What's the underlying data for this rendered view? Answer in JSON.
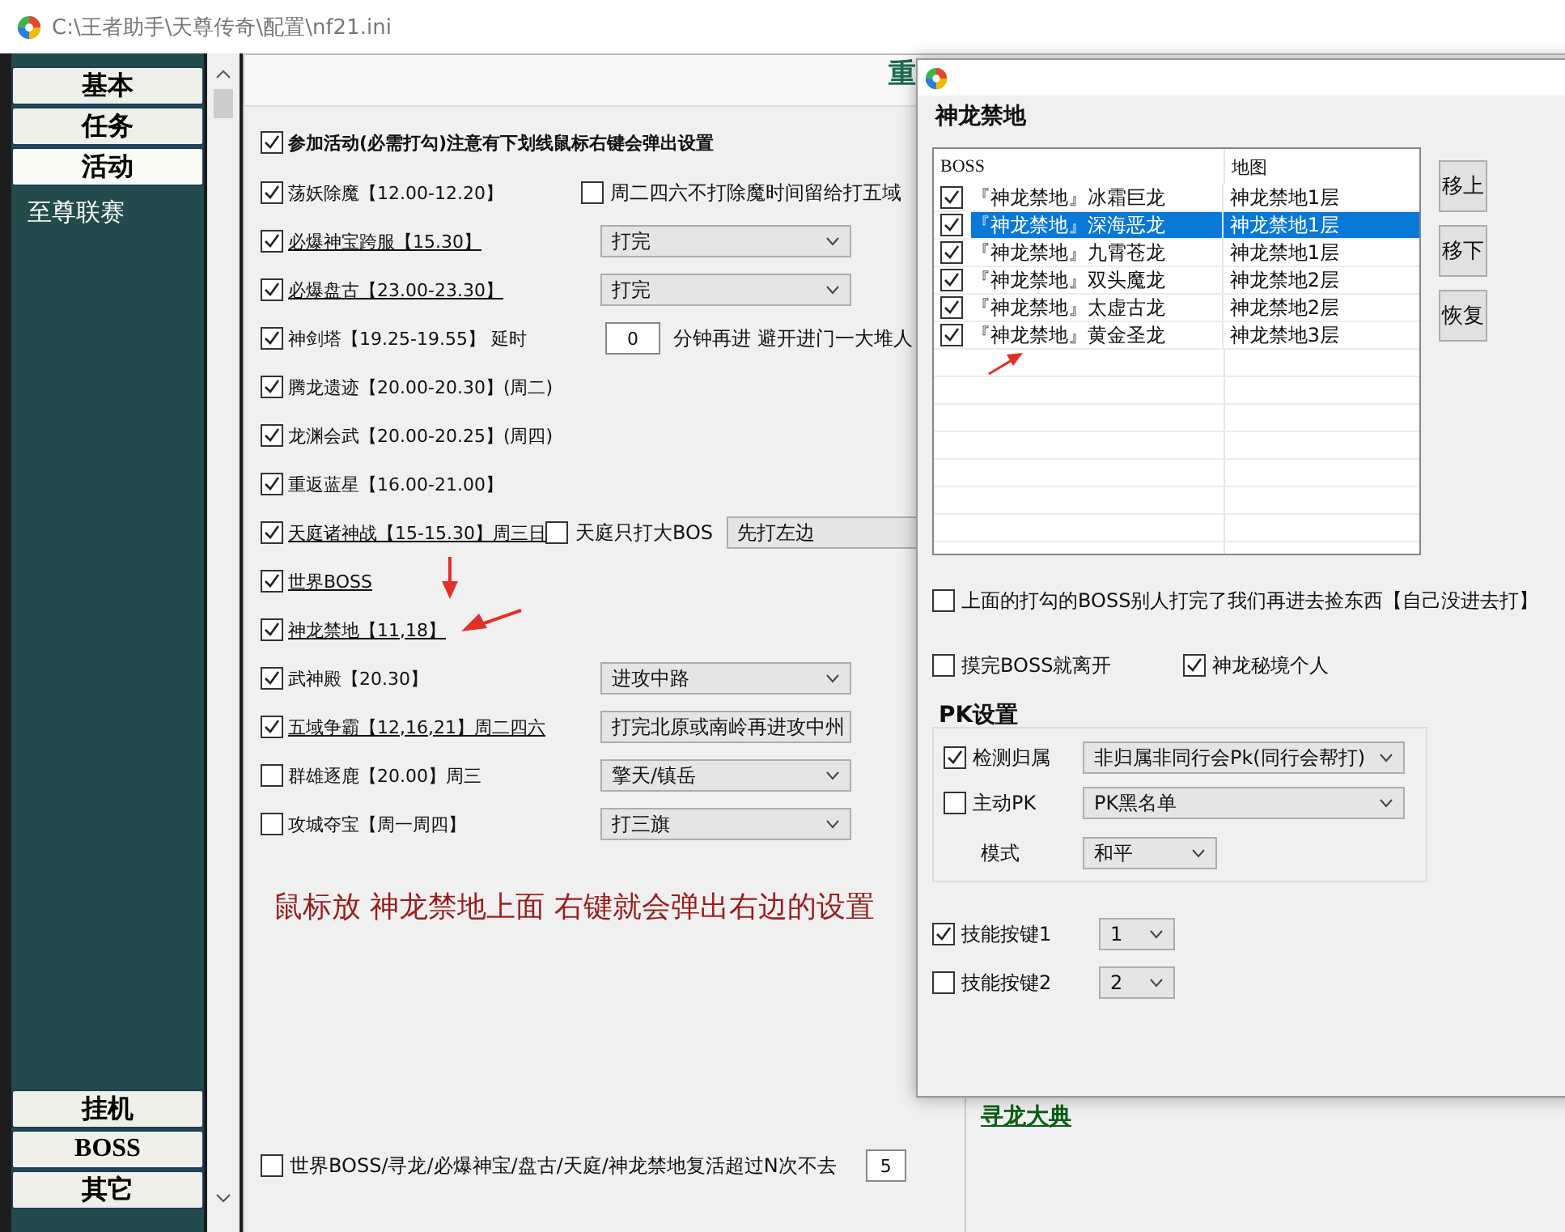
{
  "window": {
    "title": "C:\\王者助手\\天尊传奇\\配置\\nf21.ini"
  },
  "sidebar": {
    "top_tabs": [
      {
        "label": "基本",
        "selected": false
      },
      {
        "label": "任务",
        "selected": false
      },
      {
        "label": "活动",
        "selected": true
      }
    ],
    "items": [
      "至尊联赛"
    ],
    "bottom_tabs": [
      {
        "label": "挂机",
        "selected": false
      },
      {
        "label": "BOSS",
        "selected": false
      },
      {
        "label": "其它",
        "selected": false
      }
    ]
  },
  "main": {
    "header_fragment": "重",
    "master": {
      "label": "参加活动(必需打勾)注意有下划线鼠标右键会弹出设置",
      "checked": true
    },
    "activities": [
      {
        "label": "荡妖除魔【12.00-12.20】",
        "checked": true,
        "underlined": false,
        "controls": [
          {
            "kind": "checkbox",
            "label": "周二四六不打除魔时间留给打五域",
            "checked": false
          }
        ]
      },
      {
        "label": "必爆神宝跨服【15.30】",
        "checked": true,
        "underlined": true,
        "controls": [
          {
            "kind": "select",
            "value": "打完"
          }
        ]
      },
      {
        "label": "必爆盘古【23.00-23.30】",
        "checked": true,
        "underlined": true,
        "controls": [
          {
            "kind": "select",
            "value": "打完"
          }
        ]
      },
      {
        "label": "神剑塔【19.25-19.55】 延时",
        "checked": true,
        "underlined": false,
        "controls": [
          {
            "kind": "number",
            "value": "0"
          },
          {
            "kind": "text",
            "label": "分钟再进 避开进门一大堆人"
          }
        ]
      },
      {
        "label": "腾龙遗迹【20.00-20.30】(周二)",
        "checked": true,
        "underlined": false
      },
      {
        "label": "龙渊会武【20.00-20.25】(周四)",
        "checked": true,
        "underlined": false
      },
      {
        "label": "重返蓝星【16.00-21.00】",
        "checked": true,
        "underlined": false
      },
      {
        "label": "天庭诸神战【15-15.30】周三日",
        "checked": true,
        "underlined": true,
        "controls": [
          {
            "kind": "checkbox",
            "label": "天庭只打大BOS",
            "checked": false
          },
          {
            "kind": "select",
            "value": "先打左边"
          }
        ]
      },
      {
        "label": "世界BOSS",
        "checked": true,
        "underlined": true
      },
      {
        "label": "神龙禁地【11,18】",
        "checked": true,
        "underlined": true
      },
      {
        "label": "武神殿【20.30】",
        "checked": true,
        "underlined": false,
        "controls": [
          {
            "kind": "select",
            "value": "进攻中路"
          }
        ]
      },
      {
        "label": "五域争霸【12,16,21】周二四六",
        "checked": true,
        "underlined": true,
        "controls": [
          {
            "kind": "select",
            "value": "打完北原或南岭再进攻中州"
          }
        ]
      },
      {
        "label": "群雄逐鹿【20.00】周三",
        "checked": false,
        "underlined": false,
        "controls": [
          {
            "kind": "select",
            "value": "擎天/镇岳"
          }
        ]
      },
      {
        "label": "攻城夺宝【周一周四】",
        "checked": false,
        "underlined": false,
        "controls": [
          {
            "kind": "select",
            "value": "打三旗"
          }
        ]
      }
    ],
    "hint": "鼠标放 神龙禁地上面 右键就会弹出右边的设置",
    "revive": {
      "label": "世界BOSS/寻龙/必爆神宝/盘古/天庭/神龙禁地复活超过N次不去",
      "checked": false,
      "value": "5"
    },
    "link": "寻龙大典"
  },
  "dialog": {
    "group_title": "神龙禁地",
    "columns": [
      "BOSS",
      "地图"
    ],
    "rows": [
      {
        "boss": "『神龙禁地』冰霜巨龙",
        "map": "神龙禁地1层",
        "checked": true,
        "selected": false
      },
      {
        "boss": "『神龙禁地』深海恶龙",
        "map": "神龙禁地1层",
        "checked": true,
        "selected": true
      },
      {
        "boss": "『神龙禁地』九霄苍龙",
        "map": "神龙禁地1层",
        "checked": true,
        "selected": false
      },
      {
        "boss": "『神龙禁地』双头魔龙",
        "map": "神龙禁地2层",
        "checked": true,
        "selected": false
      },
      {
        "boss": "『神龙禁地』太虚古龙",
        "map": "神龙禁地2层",
        "checked": true,
        "selected": false
      },
      {
        "boss": "『神龙禁地』黄金圣龙",
        "map": "神龙禁地3层",
        "checked": true,
        "selected": false
      }
    ],
    "buttons": [
      "移上",
      "移下",
      "恢复"
    ],
    "pickup": {
      "label": "上面的打勾的BOSS别人打完了我们再进去捡东西【自己没进去打】",
      "checked": false
    },
    "options": [
      {
        "label": "摸完BOSS就离开",
        "checked": false
      },
      {
        "label": "神龙秘境个人",
        "checked": true
      }
    ],
    "pk": {
      "title": "PK设置",
      "rows": [
        {
          "kind": "checkbox",
          "label": "检测归属",
          "checked": true,
          "value": "非归属非同行会Pk(同行会帮打)"
        },
        {
          "kind": "checkbox",
          "label": "主动PK",
          "checked": false,
          "value": "PK黑名单"
        },
        {
          "kind": "label",
          "label": "模式",
          "value": "和平"
        }
      ]
    },
    "skills": [
      {
        "label": "技能按键1",
        "checked": true,
        "value": "1"
      },
      {
        "label": "技能按键2",
        "checked": false,
        "value": "2"
      }
    ]
  }
}
